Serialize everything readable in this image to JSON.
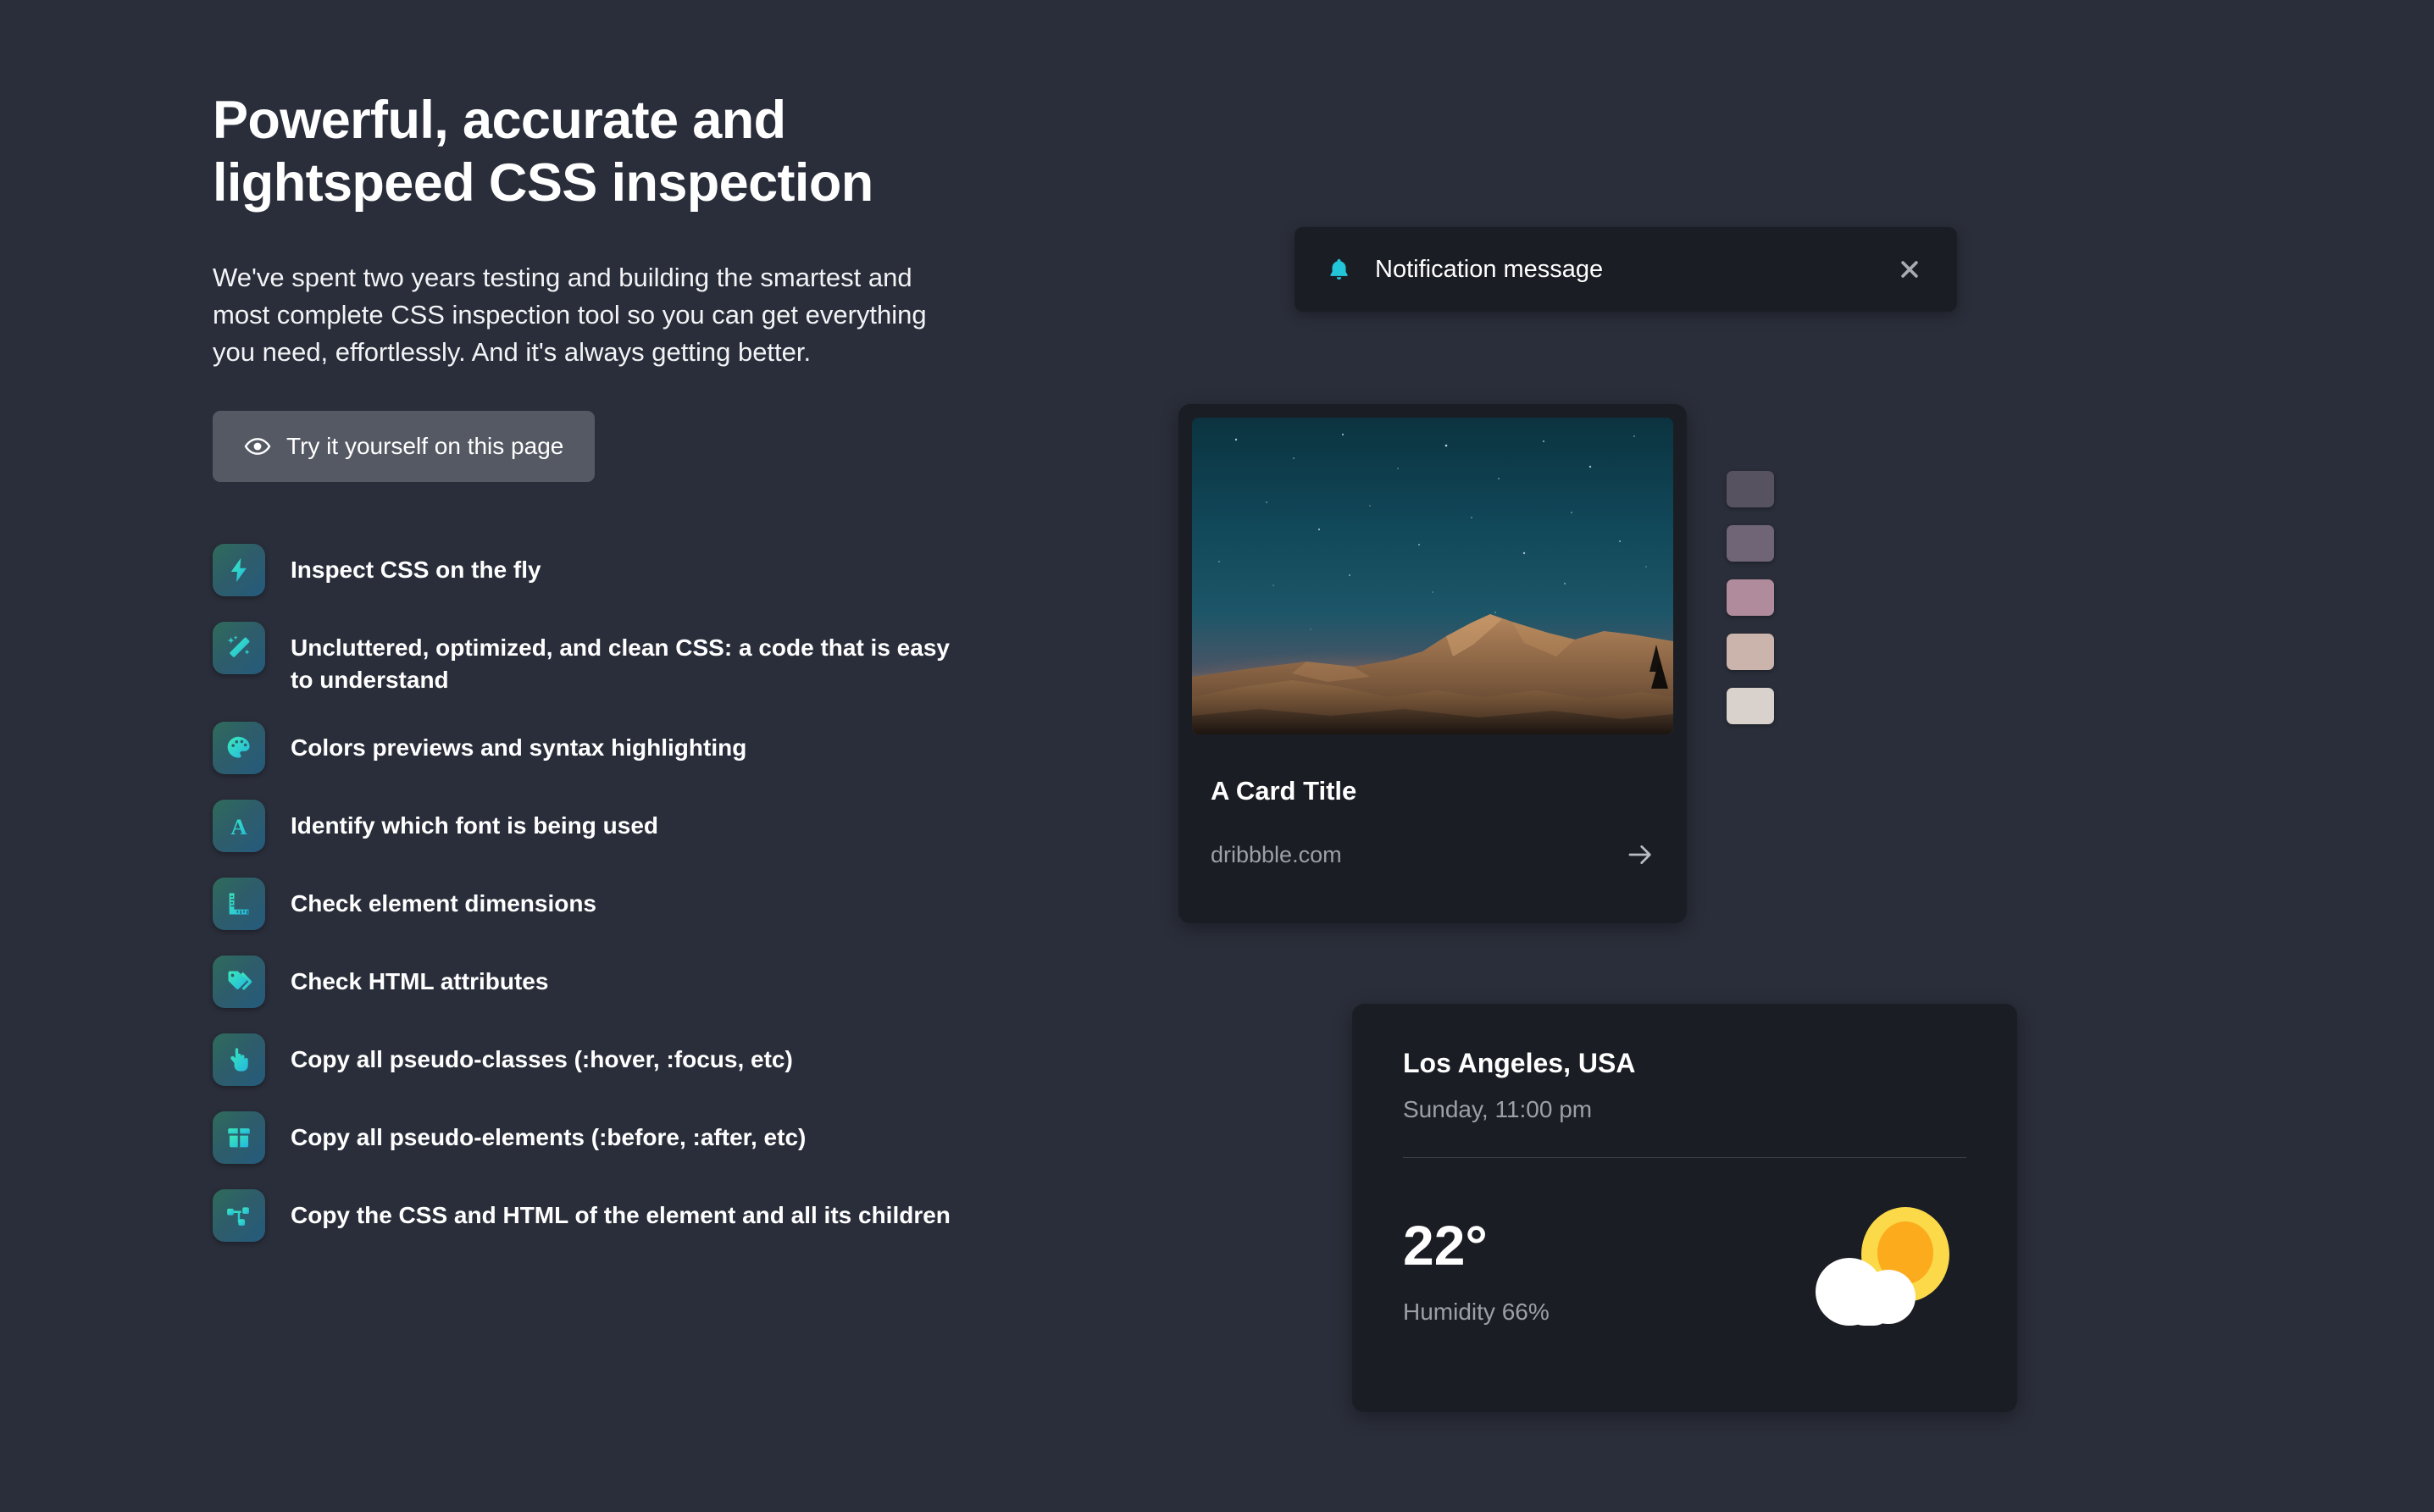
{
  "hero": {
    "headline": "Powerful, accurate and lightspeed CSS inspection",
    "subtext": "We've spent two years testing and building the smartest and most complete CSS inspection tool so you can get everything you need, effortlessly. And it's always getting better.",
    "cta_label": "Try it yourself on this page",
    "cta_icon": "eye-icon"
  },
  "features": [
    {
      "icon": "lightning-bolt-icon",
      "label": "Inspect CSS on the fly"
    },
    {
      "icon": "magic-wand-icon",
      "label": "Uncluttered, optimized, and clean CSS: a code that is easy to understand"
    },
    {
      "icon": "palette-icon",
      "label": "Colors previews and syntax highlighting"
    },
    {
      "icon": "font-letter-a-icon",
      "label": "Identify which font is being used"
    },
    {
      "icon": "ruler-icon",
      "label": "Check element dimensions"
    },
    {
      "icon": "tags-icon",
      "label": "Check HTML attributes"
    },
    {
      "icon": "pointing-hand-icon",
      "label": "Copy all pseudo-classes (:hover, :focus, etc)"
    },
    {
      "icon": "box-icon",
      "label": "Copy all pseudo-elements (:before, :after, etc)"
    },
    {
      "icon": "node-tree-icon",
      "label": "Copy the CSS and HTML of the element and all its children"
    }
  ],
  "notification": {
    "icon": "bell-icon",
    "message": "Notification message",
    "close_icon": "close-icon",
    "accent_color": "#22c6d8"
  },
  "card": {
    "image_alt": "mountain-ridge-at-twilight-with-starry-sky",
    "title": "A Card Title",
    "domain": "dribbble.com",
    "arrow_icon": "arrow-right-icon"
  },
  "swatches": [
    {
      "name": "swatch-1",
      "color": "#56525f"
    },
    {
      "name": "swatch-2",
      "color": "#6f6576"
    },
    {
      "name": "swatch-3",
      "color": "#b08b9b"
    },
    {
      "name": "swatch-4",
      "color": "#cbb4ab"
    },
    {
      "name": "swatch-5",
      "color": "#d9d2cc"
    }
  ],
  "weather": {
    "city": "Los Angeles, USA",
    "time": "Sunday, 11:00 pm",
    "temperature": "22°",
    "humidity": "Humidity 66%",
    "condition_icon": "sun-behind-cloud-icon"
  },
  "theme": {
    "page_background": "#2a2e3a",
    "card_background": "#1b1d24",
    "button_background": "#555964",
    "muted_text": "#9ba0a8",
    "icon_gradient_start": "#2f6b5b",
    "icon_gradient_end": "#245b7d",
    "icon_glyph_start": "#3ce8b8",
    "icon_glyph_end": "#21b8e0"
  }
}
